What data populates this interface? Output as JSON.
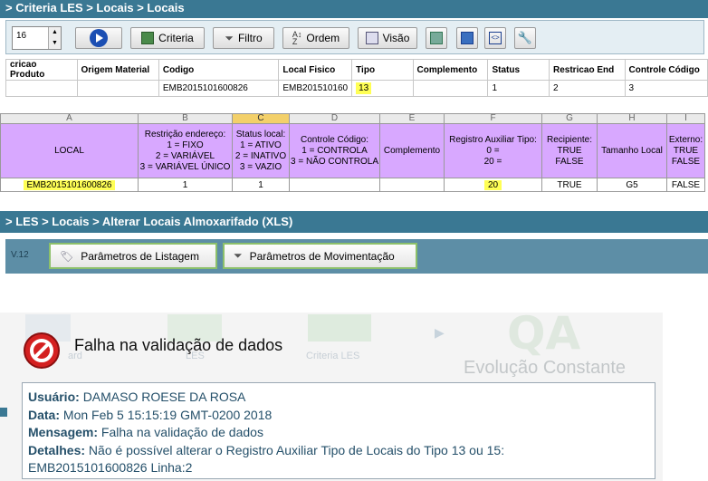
{
  "criteria_panel": {
    "breadcrumb": "> Criteria LES > Locais > Locais",
    "page_size": "16",
    "buttons": {
      "criteria": "Criteria",
      "filtro": "Filtro",
      "ordem": "Ordem",
      "visao": "Visão"
    },
    "columns": [
      "cricao Produto",
      "Origem Material",
      "Codigo",
      "Local Fisico",
      "Tipo",
      "Complemento",
      "Status",
      "Restricao End",
      "Controle Código"
    ],
    "row": [
      "",
      "",
      "EMB2015101600826",
      "EMB201510160",
      "13",
      "",
      "1",
      "2",
      "3"
    ]
  },
  "spreadsheet": {
    "column_letters": [
      "A",
      "B",
      "C",
      "D",
      "E",
      "F",
      "G",
      "H",
      "I"
    ],
    "headers": [
      [
        "LOCAL"
      ],
      [
        "Restrição endereço:",
        "1 = FIXO",
        "2 = VARIÁVEL",
        "3 = VARIÁVEL ÚNICO"
      ],
      [
        "Status local:",
        "1 = ATIVO",
        "2 = INATIVO",
        "3 = VAZIO"
      ],
      [
        "Controle Código:",
        "1 = CONTROLA",
        "3 = NÃO CONTROLA"
      ],
      [
        "Complemento"
      ],
      [
        "Registro Auxiliar Tipo:",
        "0 =",
        "20 ="
      ],
      [
        "Recipiente:",
        "TRUE",
        "FALSE"
      ],
      [
        "Tamanho Local"
      ],
      [
        "Externo:",
        "TRUE",
        "FALSE"
      ]
    ],
    "row": [
      "EMB2015101600826",
      "1",
      "1",
      "",
      "",
      "20",
      "TRUE",
      "G5",
      "FALSE"
    ]
  },
  "les_panel": {
    "breadcrumb": "> LES > Locais > Alterar Locais Almoxarifado (XLS)",
    "version": "V.12",
    "buttons": {
      "listagem": "Parâmetros de Listagem",
      "movimentacao": "Parâmetros de Movimentação"
    }
  },
  "background": {
    "tile1": "ard",
    "tile2": "LES",
    "tile3": "Criteria LES",
    "brand": "QA",
    "tagline": "Evolução Constante"
  },
  "error_dialog": {
    "title": "Falha na validação de dados",
    "usuario_label": "Usuário:",
    "usuario": "DAMASO ROESE DA ROSA",
    "data_label": "Data:",
    "data": "Mon Feb 5 15:15:19 GMT-0200 2018",
    "mensagem_label": "Mensagem:",
    "mensagem": "Falha na validação de dados",
    "detalhes_label": "Detalhes:",
    "detalhes": "Não é possível alterar o Registro Auxiliar Tipo de Locais do Tipo 13 ou 15:",
    "detalhes2": "EMB2015101600826 Linha:2"
  },
  "colors": {
    "panel_header": "#3a7893",
    "excel_header": "#d8a8ff",
    "highlight": "#ffff55",
    "error_red": "#d42020"
  }
}
